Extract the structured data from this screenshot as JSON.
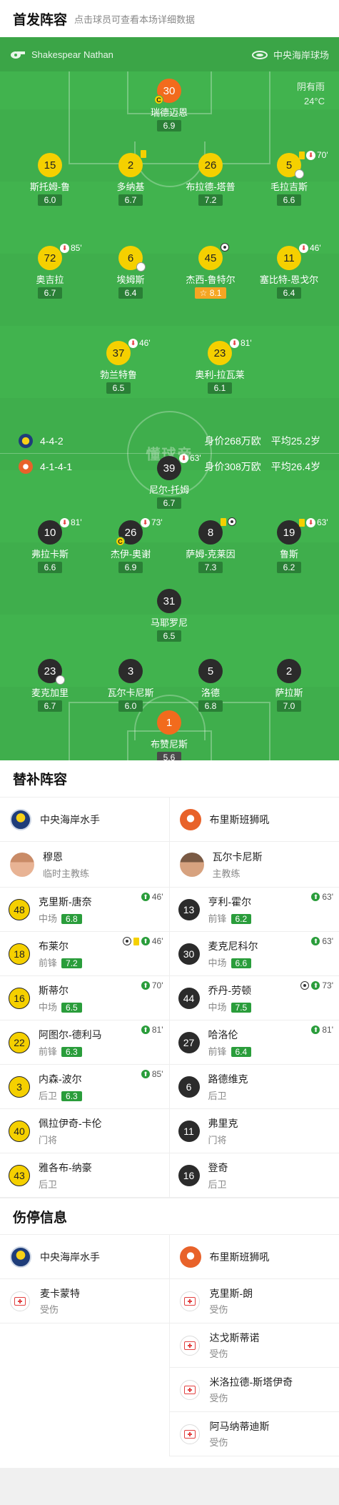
{
  "header": {
    "title": "首发阵容",
    "subtitle": "点击球员可查看本场详细数据"
  },
  "pitch": {
    "referee": "Shakespear Nathan",
    "venue": "中央海岸球场",
    "weather": "阴有雨",
    "temperature": "24°C",
    "watermark": "懂球帝",
    "home": {
      "formation": "4-4-2",
      "value": "身价268万欧",
      "avg_age": "平均25.2岁"
    },
    "away": {
      "formation": "4-1-4-1",
      "value": "身价308万欧",
      "avg_age": "平均26.4岁"
    },
    "home_players": [
      {
        "num": "30",
        "name": "瑞德迈恩",
        "rating": "6.9",
        "color": "o",
        "captain": true
      },
      {
        "num": "15",
        "name": "斯托姆-鲁",
        "rating": "6.0",
        "color": "y"
      },
      {
        "num": "2",
        "name": "多纳基",
        "rating": "6.7",
        "color": "y",
        "yellow": true
      },
      {
        "num": "26",
        "name": "布拉德-塔普",
        "rating": "7.2",
        "color": "y"
      },
      {
        "num": "5",
        "name": "毛拉吉斯",
        "rating": "6.6",
        "color": "y",
        "yellow": true,
        "sub": "70'",
        "boot": true
      },
      {
        "num": "72",
        "name": "奥吉拉",
        "rating": "6.7",
        "color": "y",
        "sub": "85'"
      },
      {
        "num": "6",
        "name": "埃姆斯",
        "rating": "6.4",
        "color": "y",
        "boot": true
      },
      {
        "num": "45",
        "name": "杰西-鲁特尔",
        "rating": "8.1",
        "color": "y",
        "star": true,
        "goal": true
      },
      {
        "num": "11",
        "name": "塞比特-恩戈尔",
        "rating": "6.4",
        "color": "y",
        "sub": "46'"
      },
      {
        "num": "37",
        "name": "勃兰特鲁",
        "rating": "6.5",
        "color": "y",
        "sub": "46'"
      },
      {
        "num": "23",
        "name": "奥利-拉瓦莱",
        "rating": "6.1",
        "color": "y",
        "sub": "81'"
      }
    ],
    "away_players": [
      {
        "num": "39",
        "name": "尼尔-托姆",
        "rating": "6.7",
        "color": "d",
        "sub": "63'"
      },
      {
        "num": "10",
        "name": "弗拉卡斯",
        "rating": "6.6",
        "color": "d",
        "sub": "81'"
      },
      {
        "num": "26",
        "name": "杰伊-奥谢",
        "rating": "6.9",
        "color": "d",
        "sub": "73'",
        "captain": true
      },
      {
        "num": "8",
        "name": "萨姆-克莱因",
        "rating": "7.3",
        "color": "d",
        "yellow": true,
        "goal": true
      },
      {
        "num": "19",
        "name": "鲁斯",
        "rating": "6.2",
        "color": "d",
        "yellow": true,
        "sub": "63'"
      },
      {
        "num": "31",
        "name": "马耶罗尼",
        "rating": "6.5",
        "color": "d"
      },
      {
        "num": "23",
        "name": "麦克加里",
        "rating": "6.7",
        "color": "d",
        "boot": true
      },
      {
        "num": "3",
        "name": "瓦尔卡尼斯",
        "rating": "6.0",
        "color": "d"
      },
      {
        "num": "5",
        "name": "洛德",
        "rating": "6.8",
        "color": "d"
      },
      {
        "num": "2",
        "name": "萨拉斯",
        "rating": "7.0",
        "color": "d"
      },
      {
        "num": "1",
        "name": "布赞尼斯",
        "rating": "5.6",
        "color": "o",
        "gk": true
      }
    ]
  },
  "subs": {
    "title": "替补阵容",
    "home_team": "中央海岸水手",
    "away_team": "布里斯班狮吼",
    "home_coach": {
      "name": "穆恩",
      "role": "临时主教练"
    },
    "away_coach": {
      "name": "瓦尔卡尼斯",
      "role": "主教练"
    },
    "home": [
      {
        "num": "48",
        "name": "克里斯-唐奈",
        "pos": "中场",
        "rating": "6.8",
        "in": "46'"
      },
      {
        "num": "18",
        "name": "布莱尔",
        "pos": "前锋",
        "rating": "7.2",
        "in": "46'",
        "goal": true,
        "yellow": true
      },
      {
        "num": "16",
        "name": "斯蒂尔",
        "pos": "中场",
        "rating": "6.5",
        "in": "70'"
      },
      {
        "num": "22",
        "name": "阿图尔-德利马",
        "pos": "前锋",
        "rating": "6.3",
        "in": "81'"
      },
      {
        "num": "3",
        "name": "内森-波尔",
        "pos": "后卫",
        "rating": "6.3",
        "in": "85'"
      },
      {
        "num": "40",
        "name": "佩拉伊奇-卡伦",
        "pos": "门将"
      },
      {
        "num": "43",
        "name": "雅各布-纳豪",
        "pos": "后卫"
      }
    ],
    "away": [
      {
        "num": "13",
        "name": "亨利-霍尔",
        "pos": "前锋",
        "rating": "6.2",
        "in": "63'"
      },
      {
        "num": "30",
        "name": "麦克尼科尔",
        "pos": "中场",
        "rating": "6.6",
        "in": "63'"
      },
      {
        "num": "44",
        "name": "乔丹-劳顿",
        "pos": "中场",
        "rating": "7.5",
        "in": "73'",
        "goal": true
      },
      {
        "num": "27",
        "name": "哈洛伦",
        "pos": "前锋",
        "rating": "6.4",
        "in": "81'"
      },
      {
        "num": "6",
        "name": "路德维克",
        "pos": "后卫"
      },
      {
        "num": "11",
        "name": "弗里克",
        "pos": "门将"
      },
      {
        "num": "16",
        "name": "登奇",
        "pos": "后卫"
      }
    ]
  },
  "injuries": {
    "title": "伤停信息",
    "home_team": "中央海岸水手",
    "away_team": "布里斯班狮吼",
    "home": [
      {
        "name": "麦卡蒙特",
        "status": "受伤"
      }
    ],
    "away": [
      {
        "name": "克里斯-朗",
        "status": "受伤"
      },
      {
        "name": "达戈斯蒂诺",
        "status": "受伤"
      },
      {
        "name": "米洛拉德-斯塔伊奇",
        "status": "受伤"
      },
      {
        "name": "阿马纳蒂迪斯",
        "status": "受伤"
      }
    ]
  }
}
